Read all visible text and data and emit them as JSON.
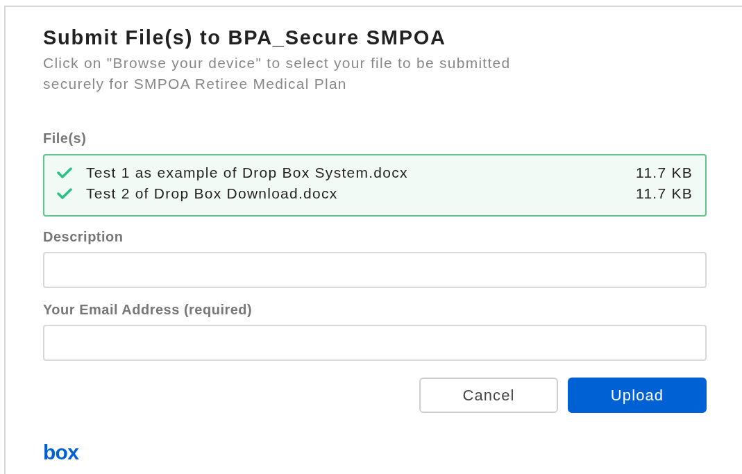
{
  "dialog": {
    "title": "Submit File(s) to BPA_Secure SMPOA",
    "description": "Click on \"Browse your device\" to select your file to be submitted securely for SMPOA Retiree Medical Plan"
  },
  "files": {
    "label": "File(s)",
    "items": [
      {
        "name": "Test 1 as example of Drop Box System.docx",
        "size": "11.7 KB",
        "uploaded": true
      },
      {
        "name": "Test 2 of Drop Box Download.docx",
        "size": "11.7 KB",
        "uploaded": true
      }
    ]
  },
  "fields": [
    {
      "label": "Description"
    },
    {
      "label": "Your Email Address (required)"
    }
  ],
  "buttons": [
    {
      "label": "Cancel",
      "kind": "secondary"
    },
    {
      "label": "Upload",
      "kind": "primary"
    }
  ],
  "logo": "box"
}
